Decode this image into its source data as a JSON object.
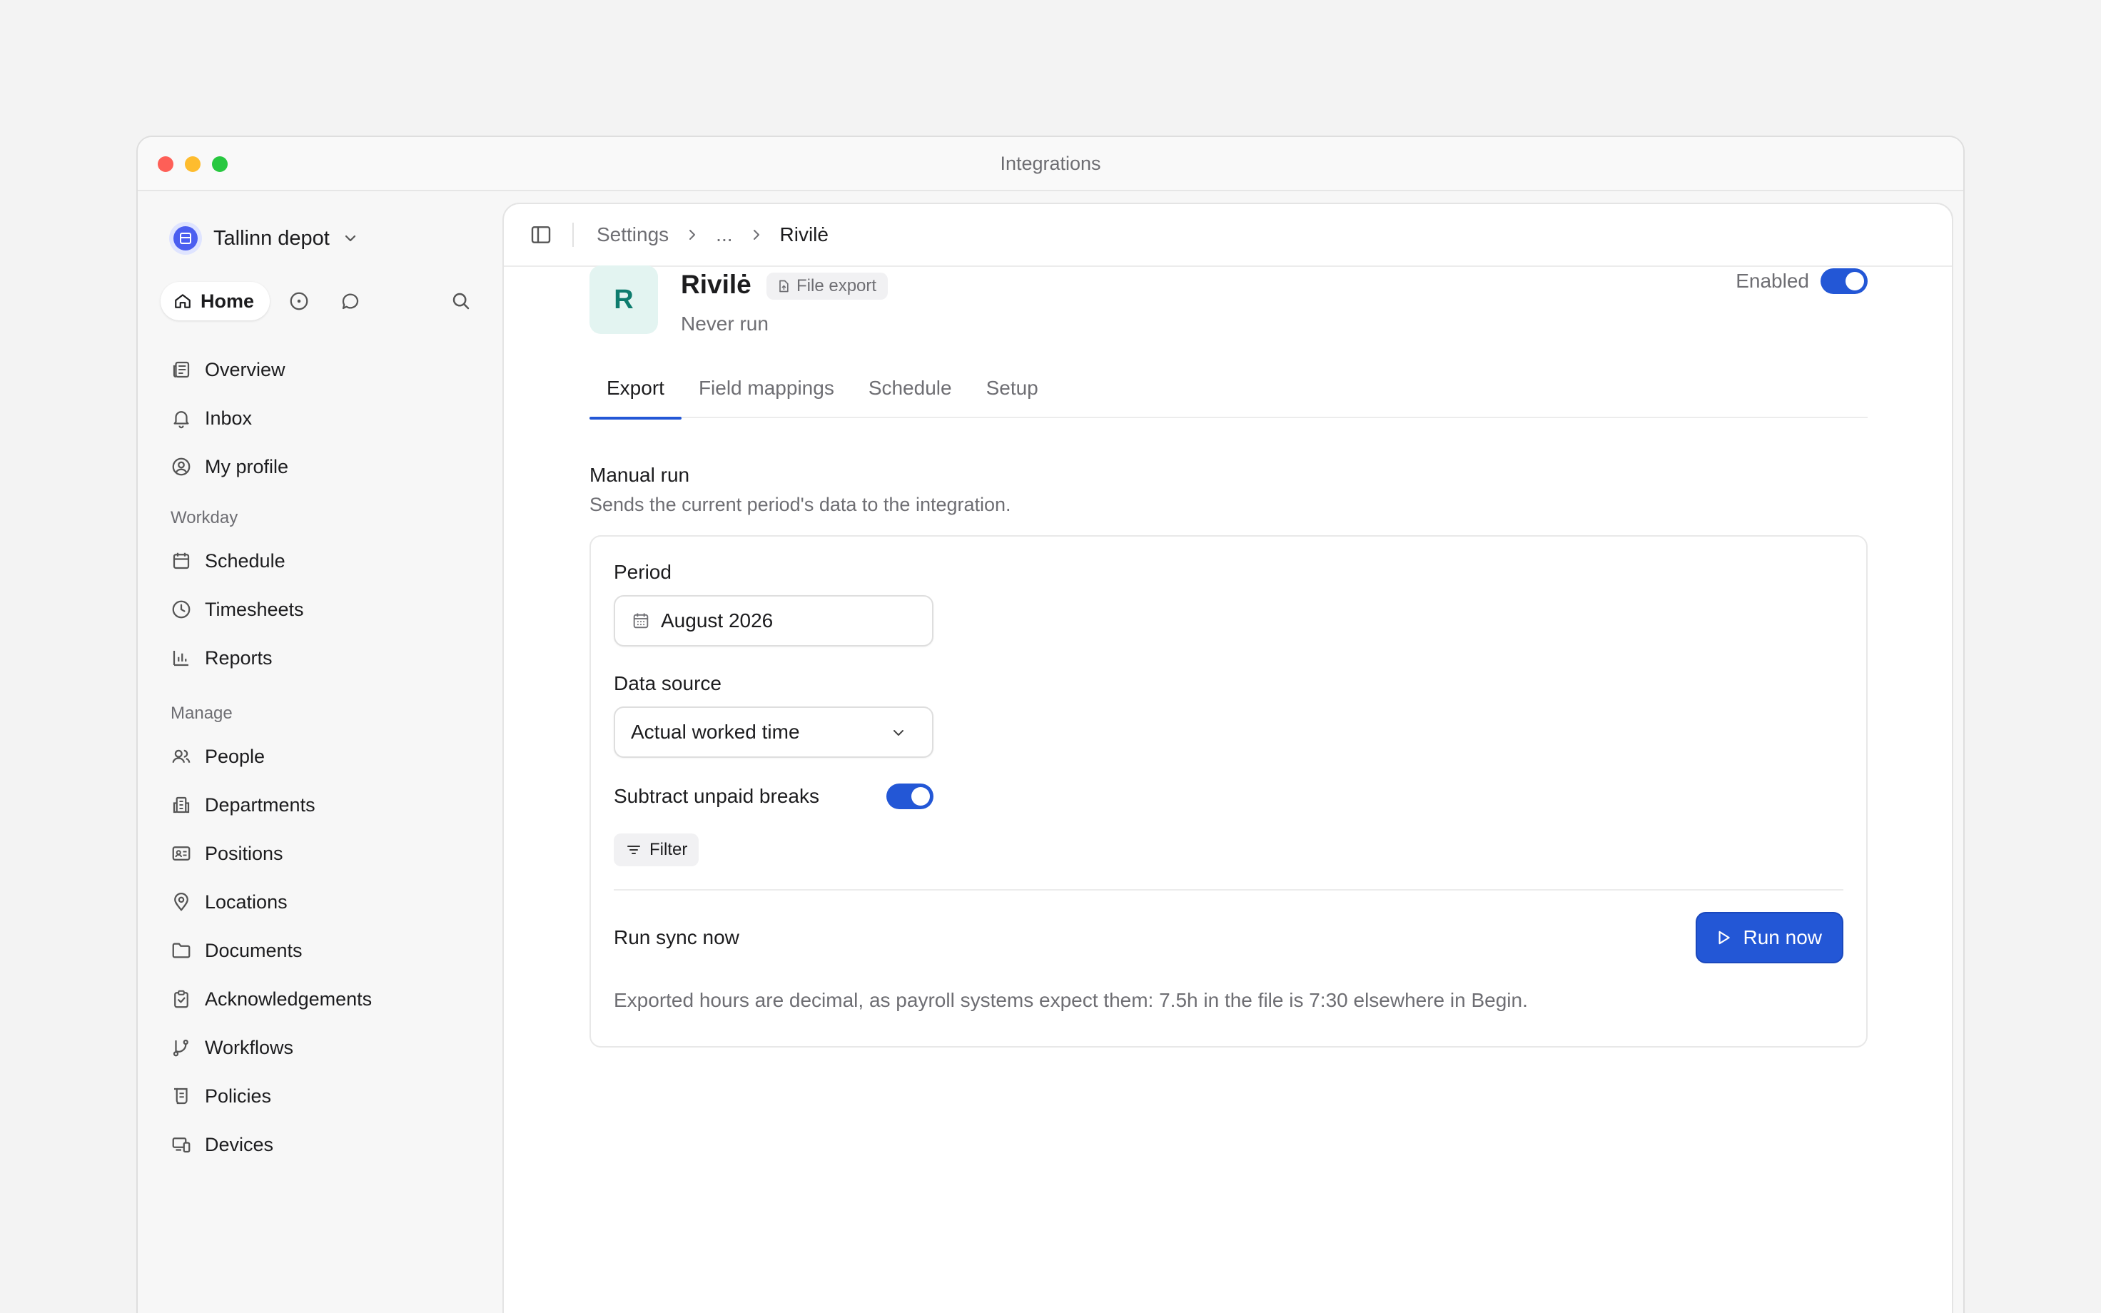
{
  "window": {
    "title": "Integrations"
  },
  "sidebar": {
    "workspace": "Tallinn depot",
    "home_label": "Home",
    "primary": [
      {
        "label": "Overview",
        "icon": "newspaper-icon"
      },
      {
        "label": "Inbox",
        "icon": "bell-icon"
      },
      {
        "label": "My profile",
        "icon": "user-circle-icon"
      }
    ],
    "sections": [
      {
        "title": "Workday",
        "items": [
          {
            "label": "Schedule",
            "icon": "calendar-icon"
          },
          {
            "label": "Timesheets",
            "icon": "clock-icon"
          },
          {
            "label": "Reports",
            "icon": "bar-chart-icon"
          }
        ]
      },
      {
        "title": "Manage",
        "items": [
          {
            "label": "People",
            "icon": "users-icon"
          },
          {
            "label": "Departments",
            "icon": "building-icon"
          },
          {
            "label": "Positions",
            "icon": "id-card-icon"
          },
          {
            "label": "Locations",
            "icon": "map-pin-icon"
          },
          {
            "label": "Documents",
            "icon": "folder-icon"
          },
          {
            "label": "Acknowledgements",
            "icon": "clipboard-check-icon"
          },
          {
            "label": "Workflows",
            "icon": "git-branch-icon"
          },
          {
            "label": "Policies",
            "icon": "scroll-icon"
          },
          {
            "label": "Devices",
            "icon": "devices-icon"
          }
        ]
      }
    ]
  },
  "breadcrumb": {
    "root": "Settings",
    "middle": "...",
    "current": "Rivilė"
  },
  "integration": {
    "avatar_letter": "R",
    "name": "Rivilė",
    "badge": "File export",
    "status": "Never run",
    "enabled_label": "Enabled",
    "enabled": true
  },
  "tabs": [
    "Export",
    "Field mappings",
    "Schedule",
    "Setup"
  ],
  "active_tab": "Export",
  "manual_run": {
    "title": "Manual run",
    "description": "Sends the current period's data to the integration.",
    "period_label": "Period",
    "period_value": "August 2026",
    "source_label": "Data source",
    "source_value": "Actual worked time",
    "breaks_label": "Subtract unpaid breaks",
    "breaks_enabled": true,
    "filter_label": "Filter",
    "run_label": "Run sync now",
    "run_button": "Run now",
    "footnote": "Exported hours are decimal, as payroll systems expect them: 7.5h in the file is 7:30 elsewhere in Begin."
  },
  "colors": {
    "accent": "#2357d6",
    "avatar_bg": "#e3f4f1",
    "avatar_fg": "#0e7c6e"
  }
}
